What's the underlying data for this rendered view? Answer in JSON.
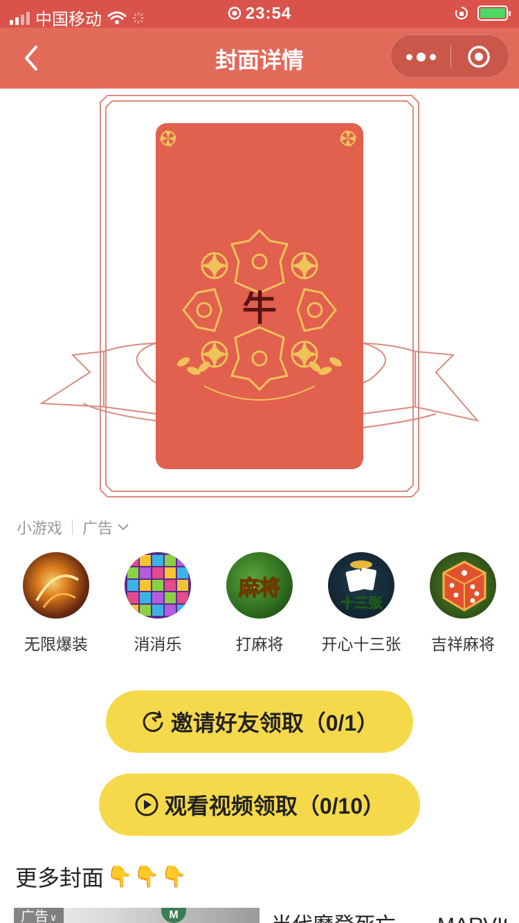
{
  "status_bar": {
    "carrier": "中国移动",
    "time": "23:54"
  },
  "nav": {
    "title": "封面详情"
  },
  "cover": {
    "center_char": "牛",
    "card_color": "#e2604e"
  },
  "mini_games": {
    "label": "小游戏",
    "ad_label": "广告",
    "items": [
      {
        "name": "无限爆装",
        "icon": "fiery-warrior-icon"
      },
      {
        "name": "消消乐",
        "icon": "star-blocks-icon"
      },
      {
        "name": "打麻将",
        "icon": "mahjong-icon",
        "icon_text": "麻将"
      },
      {
        "name": "开心十三张",
        "icon": "cards-icon",
        "icon_text": "十三张"
      },
      {
        "name": "吉祥麻将",
        "icon": "dice-icon"
      }
    ]
  },
  "buttons": {
    "invite": "邀请好友领取（0/1）",
    "video": "观看视频领取（0/10）"
  },
  "more_covers": {
    "title": "更多封面",
    "emoji": "👇👇👇",
    "ad_tag": "广告",
    "first_item_title": "当代摩登死亡——MARVIS",
    "thumb_badge": "M"
  },
  "colors": {
    "status_bar": "#d9534a",
    "nav_bar": "#e26a59",
    "button": "#f6d94b",
    "gold": "#e9b64a"
  }
}
